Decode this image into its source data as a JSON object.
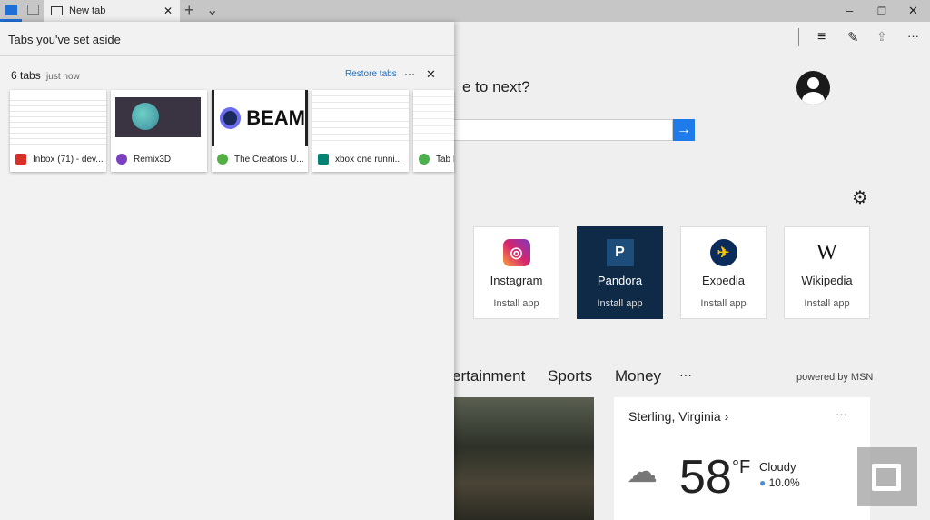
{
  "tabbar": {
    "tab_title": "New tab",
    "new_tab": "+",
    "tab_list": "⌄"
  },
  "window": {
    "minimize": "–",
    "restore": "❐",
    "close": "✕"
  },
  "toolbar": {
    "more": "···"
  },
  "panel": {
    "title": "Tabs you've set aside",
    "count": "6 tabs",
    "time": "just now",
    "restore": "Restore tabs",
    "more": "···",
    "close": "✕",
    "tabs": [
      {
        "label": "Inbox (71) - dev...",
        "color": "#d93025"
      },
      {
        "label": "Remix3D",
        "color": "#7b3fc4"
      },
      {
        "label": "The Creators U...",
        "color": "#52b043"
      },
      {
        "label": "xbox one runni...",
        "color": "#008373"
      },
      {
        "label": "Tab F",
        "color": "#4caf50"
      }
    ],
    "beam": "BEAM"
  },
  "main": {
    "question": "e to next?",
    "search_placeholder": "",
    "tiles": [
      {
        "name": "Instagram",
        "action": "Install app",
        "glyph": "◎"
      },
      {
        "name": "Pandora",
        "action": "Install app",
        "glyph": "P"
      },
      {
        "name": "Expedia",
        "action": "Install app",
        "glyph": "✈"
      },
      {
        "name": "Wikipedia",
        "action": "Install app",
        "glyph": "W"
      }
    ],
    "categories": [
      "ertainment",
      "Sports",
      "Money"
    ],
    "more": "···",
    "powered": "powered by MSN",
    "weather": {
      "location": "Sterling, Virginia",
      "chevron": "›",
      "more": "···",
      "temp": "58",
      "unit": "°F",
      "condition": "Cloudy",
      "precip": "10.0%"
    }
  }
}
